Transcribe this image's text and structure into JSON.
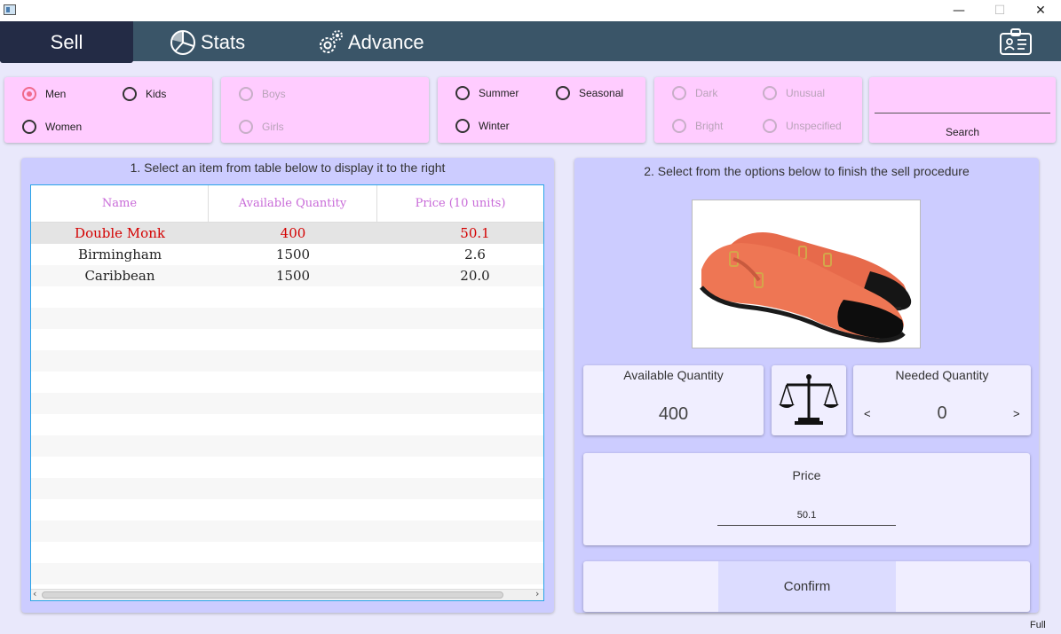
{
  "window": {
    "minimize": "—",
    "maximize": "☐",
    "close": "✕"
  },
  "nav": {
    "tabs": [
      {
        "label": "Sell",
        "icon": "none",
        "active": true
      },
      {
        "label": "Stats",
        "icon": "pie-chart-icon"
      },
      {
        "label": "Advance",
        "icon": "gears-icon"
      }
    ],
    "right_icon": "id-card-icon"
  },
  "filters": {
    "gender": {
      "options": [
        "Men",
        "Kids",
        "Women"
      ],
      "selected": "Men"
    },
    "kids": {
      "options": [
        "Boys",
        "Girls"
      ],
      "disabled": true
    },
    "season": {
      "options": [
        "Summer",
        "Seasonal",
        "Winter"
      ]
    },
    "shade": {
      "options": [
        "Dark",
        "Unusual",
        "Bright",
        "Unspecified"
      ],
      "disabled": true
    },
    "search": {
      "value": "",
      "label": "Search"
    }
  },
  "left_panel": {
    "title": "1. Select an item from table below to display it to the right",
    "columns": [
      "Name",
      "Available Quantity",
      "Price (10 units)"
    ],
    "rows": [
      {
        "name": "Double Monk",
        "qty": "400",
        "price": "50.1",
        "selected": true
      },
      {
        "name": "Birmingham",
        "qty": "1500",
        "price": "2.6"
      },
      {
        "name": "Caribbean",
        "qty": "1500",
        "price": "20.0"
      }
    ]
  },
  "right_panel": {
    "title": "2. Select from the options below to finish the sell procedure",
    "product_image": "double-monk-shoe-image",
    "available": {
      "title": "Available Quantity",
      "value": "400"
    },
    "scale_icon": "scale-icon",
    "needed": {
      "title": "Needed Quantity",
      "value": "0",
      "dec": "<",
      "inc": ">"
    },
    "price": {
      "title": "Price",
      "value": "50.1"
    },
    "confirm_label": "Confirm"
  },
  "status": "Full",
  "colors": {
    "nav_bg": "#3a5568",
    "nav_active": "#232b45",
    "filter_bg": "#ffccff",
    "panel_bg": "#ccccff",
    "radio_selected": "#f06a8c",
    "selected_row_text": "#d40000",
    "header_text": "#c86ad8"
  }
}
